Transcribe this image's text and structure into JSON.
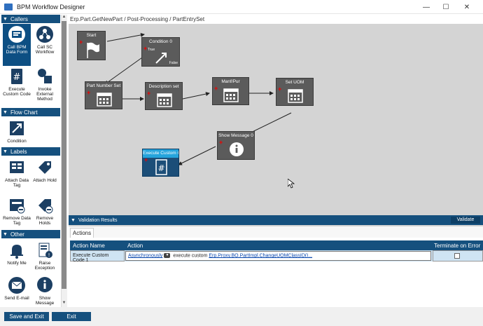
{
  "window": {
    "title": "BPM Workflow Designer",
    "minimize_glyph": "—",
    "maximize_glyph": "☐",
    "close_glyph": "✕"
  },
  "sidebar": {
    "sections": [
      {
        "label": "Callers"
      },
      {
        "label": "Flow Chart"
      },
      {
        "label": "Labels"
      },
      {
        "label": "Other"
      }
    ],
    "tools": [
      {
        "label": "Call BPM Data Form",
        "icon": "bpm-data-form-icon",
        "selected": true
      },
      {
        "label": "Call SC Workflow",
        "icon": "sc-workflow-icon"
      },
      {
        "label": "Execute Custom Code",
        "icon": "custom-code-icon"
      },
      {
        "label": "Invoke External Method",
        "icon": "external-method-icon"
      },
      {
        "label": "Condition",
        "icon": "condition-icon"
      },
      {
        "label": "Attach Data Tag",
        "icon": "attach-data-tag-icon"
      },
      {
        "label": "Attach Hold",
        "icon": "attach-hold-icon"
      },
      {
        "label": "Remove Data Tag",
        "icon": "remove-data-tag-icon"
      },
      {
        "label": "Remove Holds",
        "icon": "remove-holds-icon"
      },
      {
        "label": "Notify Me",
        "icon": "bell-icon"
      },
      {
        "label": "Raise Exception",
        "icon": "raise-exception-icon"
      },
      {
        "label": "Send E-mail",
        "icon": "envelope-icon"
      },
      {
        "label": "Show Message",
        "icon": "info-icon"
      }
    ]
  },
  "breadcrumb": "Erp.Part.GetNewPart / Post-Processing / PartEntrySet",
  "canvas": {
    "nodes": [
      {
        "label": "Start",
        "icon": "flag-icon"
      },
      {
        "label": "Condition 0",
        "icon": "condition-icon",
        "true_label": "True",
        "false_label": "False"
      },
      {
        "label": "Part Number Set",
        "icon": "calendar-icon"
      },
      {
        "label": "Description set",
        "icon": "calendar-icon"
      },
      {
        "label": "Manf/Pur",
        "icon": "calendar-icon"
      },
      {
        "label": "Set UOM",
        "icon": "calendar-icon"
      },
      {
        "label": "Show Message 0",
        "icon": "info-icon"
      },
      {
        "label": "Execute Custom Code 1",
        "icon": "custom-code-icon",
        "selected": true
      }
    ]
  },
  "validation": {
    "title": "Validation Results",
    "validate_label": "Validate"
  },
  "tabs": {
    "actions_label": "Actions"
  },
  "table": {
    "headers": {
      "action_name": "Action Name",
      "action": "Action",
      "terminate": "Terminate on Error"
    },
    "rows": [
      {
        "action_name": "Execute Custom Code 1",
        "mode": "Asynchronously",
        "verb": "execute custom",
        "code": "Erp.Proxy.BO.PartImpl.ChangeUOMClassID(I...",
        "terminate_on_error": false
      }
    ]
  },
  "footer": {
    "save_exit": "Save and Exit",
    "exit": "Exit"
  },
  "colors": {
    "accent": "#15507e",
    "node": "#5b5b5b",
    "selected_header": "#25a4dc",
    "error_plus": "#e00000"
  }
}
